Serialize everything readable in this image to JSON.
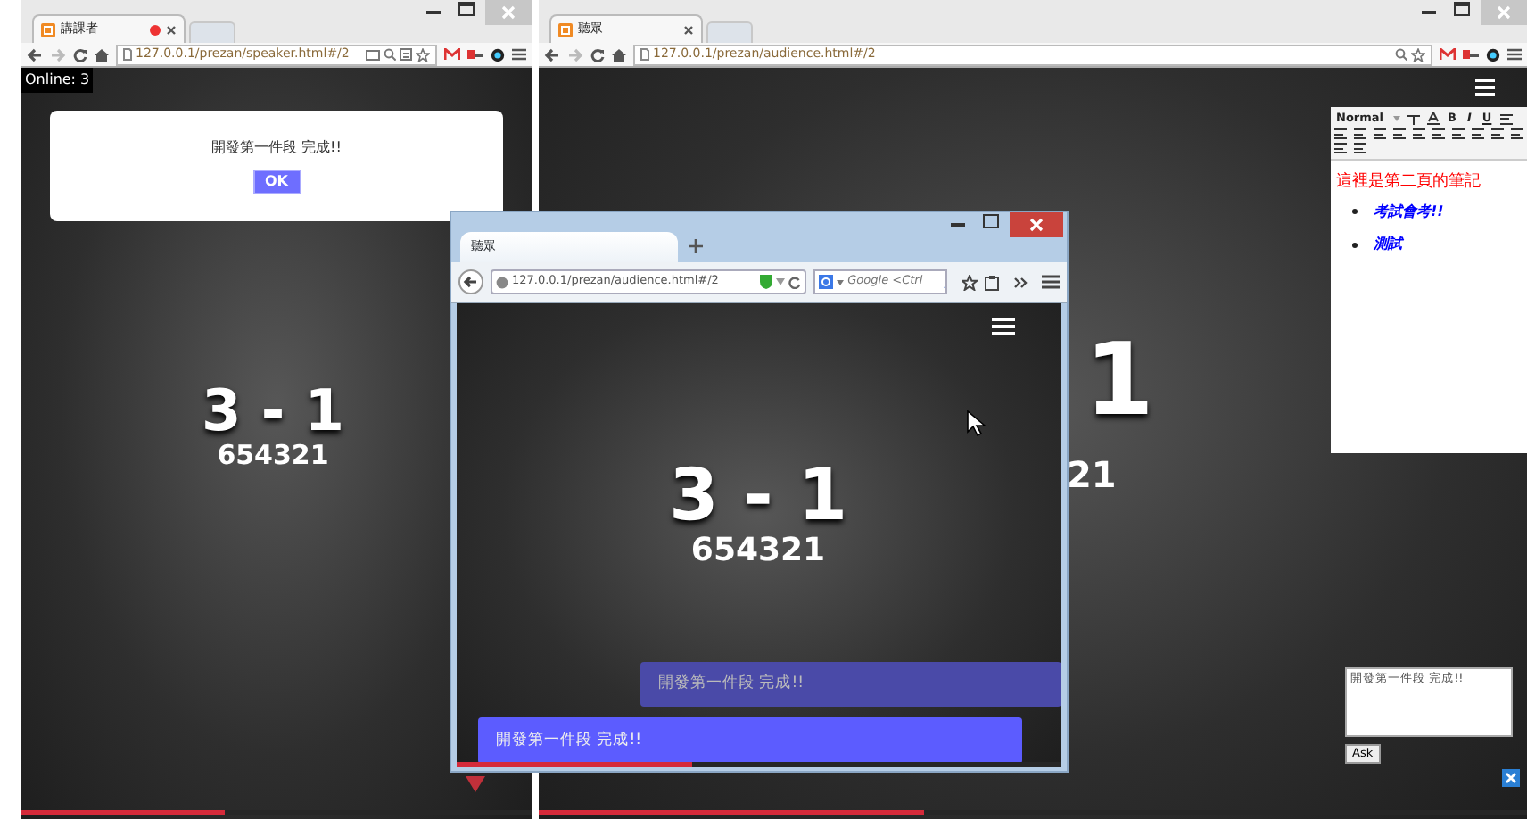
{
  "speaker_window": {
    "tab_title": "講課者",
    "url": "127.0.0.1/prezan/speaker.html#/2",
    "online_count": "Online: 3",
    "dialog": {
      "message": "開發第一件段 完成!!",
      "button": "OK"
    },
    "slide": {
      "title": "3 - 1",
      "subtitle": "654321"
    },
    "progress": {
      "level": 0.4
    }
  },
  "audience_window": {
    "tab_title": "聽眾",
    "url": "127.0.0.1/prezan/audience.html#/2",
    "slide_fragments": [
      "1",
      "21"
    ],
    "progress": {
      "level": 0.39
    },
    "notes": {
      "style_dropdown": "Normal",
      "toolbar_letters": [
        "B",
        "I",
        "U"
      ],
      "heading": "這裡是第二頁的筆記",
      "bullets": [
        "考試會考!!",
        "測試"
      ]
    },
    "question": {
      "value": "開發第一件段 完成!!",
      "button": "Ask"
    }
  },
  "firefox_window": {
    "tab_title": "聽眾",
    "url": "127.0.0.1/prezan/audience.html#/2",
    "search_placeholder": "Google <Ctrl",
    "slide": {
      "title": "3 - 1",
      "subtitle": "654321"
    },
    "messages": [
      {
        "text": "開發第一件段 完成!!",
        "kind": "faded"
      },
      {
        "text": "開發第一件段 完成!!",
        "kind": "active"
      }
    ],
    "progress": {
      "level": 0.39
    }
  }
}
